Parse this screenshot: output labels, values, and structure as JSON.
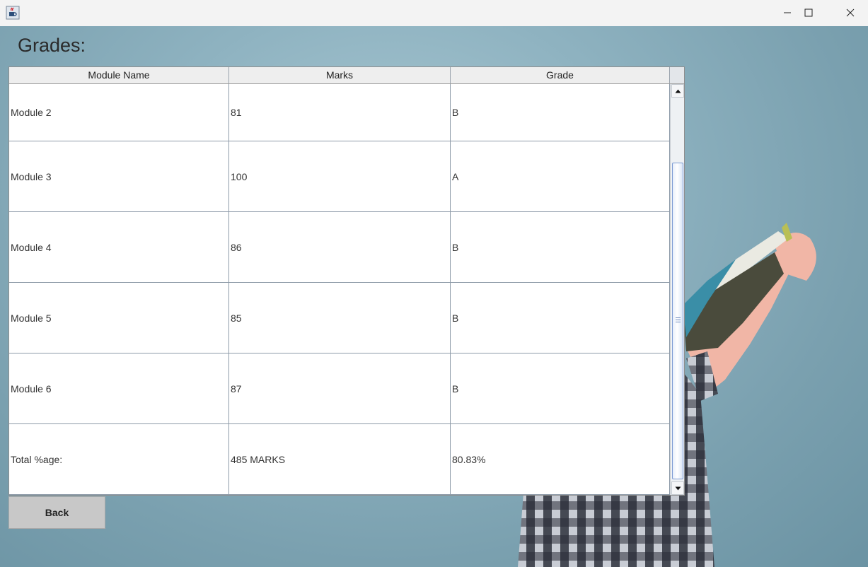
{
  "window": {
    "app_icon": "java-cup-icon",
    "controls": [
      "minimize-icon",
      "maximize-icon",
      "close-icon"
    ]
  },
  "page": {
    "title": "Grades:"
  },
  "table": {
    "columns": [
      "Module Name",
      "Marks",
      "Grade"
    ],
    "rows": [
      [
        "Module 2",
        "81",
        "B"
      ],
      [
        "Module 3",
        "100",
        "A"
      ],
      [
        "Module 4",
        "86",
        "B"
      ],
      [
        "Module 5",
        "85",
        "B"
      ],
      [
        "Module 6",
        "87",
        "B"
      ],
      [
        "Total %age:",
        "485 MARKS",
        "80.83%"
      ]
    ]
  },
  "actions": {
    "back_label": "Back"
  },
  "colors": {
    "background": "#8fb3c1",
    "thumb_border": "#7d9bd3",
    "button_face": "#c8c8c8"
  }
}
